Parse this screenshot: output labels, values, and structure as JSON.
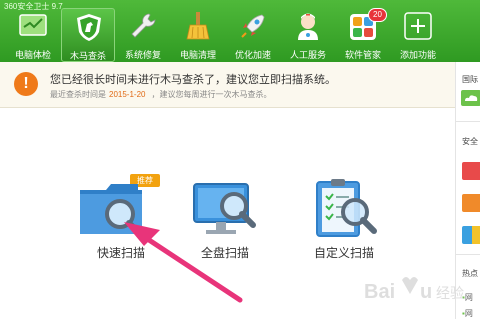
{
  "app": {
    "title": "360安全卫士 9.7"
  },
  "toolbar": {
    "items": [
      {
        "label": "电脑体检",
        "icon": "pc-check-icon"
      },
      {
        "label": "木马查杀",
        "icon": "shield-horse-icon"
      },
      {
        "label": "系统修复",
        "icon": "wrench-icon"
      },
      {
        "label": "电脑清理",
        "icon": "broom-icon"
      },
      {
        "label": "优化加速",
        "icon": "rocket-icon"
      },
      {
        "label": "人工服务",
        "icon": "doctor-icon"
      },
      {
        "label": "软件管家",
        "icon": "apps-icon",
        "badge": "20"
      },
      {
        "label": "添加功能",
        "icon": "plus-icon"
      }
    ],
    "active_index": 1
  },
  "alert": {
    "icon_text": "!",
    "title": "您已经很长时间未进行木马查杀了，建议您立即扫描系统。",
    "sub_prefix": "最近查杀时间是",
    "sub_date": "2015-1-20",
    "sub_suffix": "，建议您每周进行一次木马查杀。"
  },
  "scan_options": [
    {
      "label": "快速扫描",
      "icon": "folder-magnifier-icon",
      "tag": "推荐"
    },
    {
      "label": "全盘扫描",
      "icon": "monitor-magnifier-icon"
    },
    {
      "label": "自定义扫描",
      "icon": "clipboard-magnifier-icon"
    }
  ],
  "right_panel": {
    "top_label": "国际",
    "mid_label": "安全",
    "bottom_label": "热点",
    "list_mark": "网"
  },
  "watermark": {
    "text": "Baidu 经验"
  },
  "colors": {
    "toolbar_green": "#3aa62c",
    "alert_orange": "#ef7a1a",
    "date_orange": "#e06a16",
    "arrow_pink": "#e8347a",
    "tag_orange": "#f2a20f",
    "badge_red": "#e8333a"
  }
}
